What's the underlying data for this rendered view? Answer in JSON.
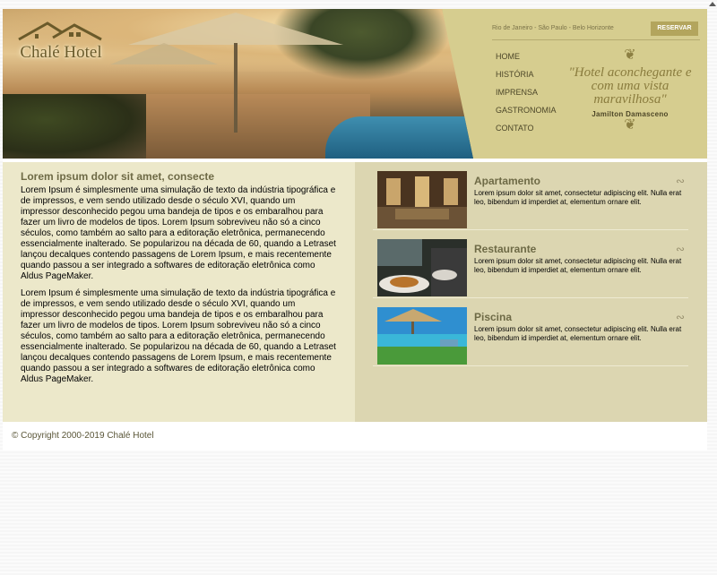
{
  "header": {
    "logo_text": "Chalé Hotel",
    "locations": "Rio de Janeiro - São Paulo - Belo Horizonte",
    "reserve_label": "RESERVAR",
    "nav": [
      "HOME",
      "HISTÓRIA",
      "IMPRENSA",
      "GASTRONOMIA",
      "CONTATO"
    ],
    "tagline": "\"Hotel aconchegante e com uma vista maravilhosa\"",
    "signature": "Jamilton Damasceno"
  },
  "article": {
    "title": "Lorem ipsum dolor sit amet, consecte",
    "paragraphs": [
      "Lorem Ipsum é simplesmente uma simulação de texto da indústria tipográfica e de impressos, e vem sendo utilizado desde o século XVI, quando um impressor desconhecido pegou uma bandeja de tipos e os embaralhou para fazer um livro de modelos de tipos. Lorem Ipsum sobreviveu não só a cinco séculos, como também ao salto para a editoração eletrônica, permanecendo essencialmente inalterado. Se popularizou na década de 60, quando a Letraset lançou decalques contendo passagens de Lorem Ipsum, e mais recentemente quando passou a ser integrado a softwares de editoração eletrônica como Aldus PageMaker.",
      "Lorem Ipsum é simplesmente uma simulação de texto da indústria tipográfica e de impressos, e vem sendo utilizado desde o século XVI, quando um impressor desconhecido pegou uma bandeja de tipos e os embaralhou para fazer um livro de modelos de tipos. Lorem Ipsum sobreviveu não só a cinco séculos, como também ao salto para a editoração eletrônica, permanecendo essencialmente inalterado. Se popularizou na década de 60, quando a Letraset lançou decalques contendo passagens de Lorem Ipsum, e mais recentemente quando passou a ser integrado a softwares de editoração eletrônica como Aldus PageMaker."
    ]
  },
  "features": [
    {
      "title": "Apartamento",
      "text": "Lorem ipsum dolor sit amet, consectetur adipiscing elit. Nulla erat leo, bibendum id imperdiet at, elementum ornare elit.",
      "icon": "swirl-icon"
    },
    {
      "title": "Restaurante",
      "text": "Lorem ipsum dolor sit amet, consectetur adipiscing elit. Nulla erat leo, bibendum id imperdiet at, elementum ornare elit.",
      "icon": "swirl-icon"
    },
    {
      "title": "Piscina",
      "text": "Lorem ipsum dolor sit amet, consectetur adipiscing elit. Nulla erat leo, bibendum id imperdiet at, elementum ornare elit.",
      "icon": "swirl-icon"
    }
  ],
  "footer": {
    "copyright": "© Copyright 2000-2019 Chalé Hotel"
  },
  "colors": {
    "header_bg": "#d6cd8f",
    "button_bg": "#b3a55d",
    "left_bg": "#ece8ca",
    "right_bg": "#dcd6b1",
    "title_color": "#6e6a46"
  }
}
